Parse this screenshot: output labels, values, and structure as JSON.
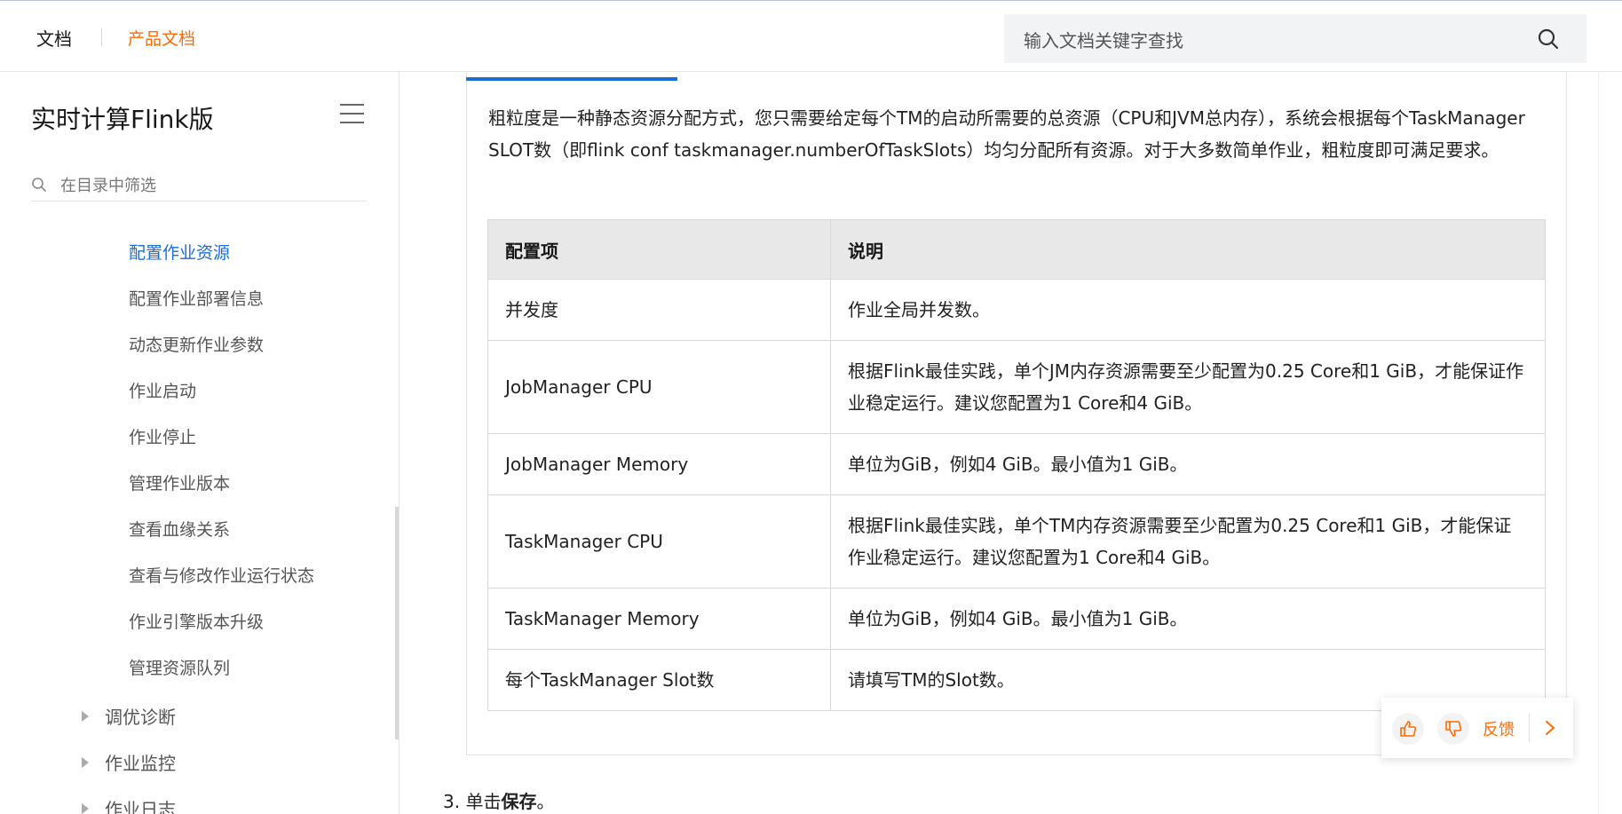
{
  "header": {
    "home_label": "文档",
    "product_label": "产品文档",
    "search_placeholder": "输入文档关键字查找"
  },
  "sidebar": {
    "title": "实时计算Flink版",
    "filter_placeholder": "在目录中筛选",
    "items": [
      {
        "label": "配置作业资源",
        "active": true
      },
      {
        "label": "配置作业部署信息"
      },
      {
        "label": "动态更新作业参数"
      },
      {
        "label": "作业启动"
      },
      {
        "label": "作业停止"
      },
      {
        "label": "管理作业版本"
      },
      {
        "label": "查看血缘关系"
      },
      {
        "label": "查看与修改作业运行状态"
      },
      {
        "label": "作业引擎版本升级"
      },
      {
        "label": "管理资源队列"
      }
    ],
    "groups": [
      {
        "label": "调优诊断"
      },
      {
        "label": "作业监控"
      },
      {
        "label": "作业日志"
      }
    ]
  },
  "content": {
    "paragraph": "粗粒度是一种静态资源分配方式，您只需要给定每个TM的启动所需要的总资源（CPU和JVM总内存），系统会根据每个TaskManager SLOT数（即flink conf taskmanager.numberOfTaskSlots）均匀分配所有资源。对于大多数简单作业，粗粒度即可满足要求。",
    "table": {
      "headers": [
        "配置项",
        "说明"
      ],
      "rows": [
        [
          "并发度",
          "作业全局并发数。"
        ],
        [
          "JobManager CPU",
          "根据Flink最佳实践，单个JM内存资源需要至少配置为0.25 Core和1 GiB，才能保证作业稳定运行。建议您配置为1 Core和4 GiB。"
        ],
        [
          "JobManager Memory",
          "单位为GiB，例如4 GiB。最小值为1 GiB。"
        ],
        [
          "TaskManager CPU",
          "根据Flink最佳实践，单个TM内存资源需要至少配置为0.25 Core和1 GiB，才能保证作业稳定运行。建议您配置为1 Core和4 GiB。"
        ],
        [
          "TaskManager Memory",
          "单位为GiB，例如4 GiB。最小值为1 GiB。"
        ],
        [
          "每个TaskManager Slot数",
          "请填写TM的Slot数。"
        ]
      ]
    },
    "step3_prefix": "3. 单击",
    "step3_bold": "保存",
    "step3_suffix": "。"
  },
  "feedback": {
    "label": "反馈"
  },
  "colors": {
    "accent_orange": "#ff6a00",
    "link_blue": "#1a6cd6"
  }
}
